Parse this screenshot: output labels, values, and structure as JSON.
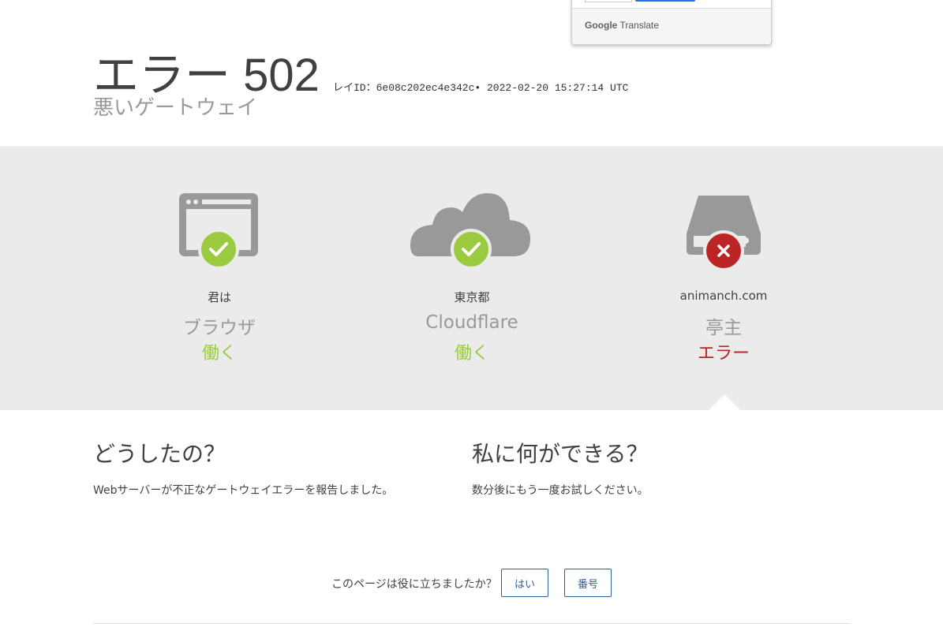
{
  "header": {
    "title": "エラー 502",
    "ray_id": "レイID：6e08c202ec4e342c• 2022-02-20 15:27:14 UTC",
    "subtitle": "悪いゲートウェイ"
  },
  "translate_popup": {
    "logo_google": "Google",
    "logo_translate": "Translate"
  },
  "status_columns": [
    {
      "location": "君は",
      "name": "ブラウザ",
      "status": "働く",
      "icon": "browser-icon",
      "result": "ok"
    },
    {
      "location": "東京都",
      "name": "Cloudflare",
      "status": "働く",
      "icon": "cloud-icon",
      "result": "ok"
    },
    {
      "location": "animanch.com",
      "name": "亭主",
      "status": "エラー",
      "icon": "server-icon",
      "result": "error"
    }
  ],
  "info": {
    "what_happened_title": "どうしたの？",
    "what_happened_text": "Webサーバーが不正なゲートウェイエラーを報告しました。",
    "what_can_i_do_title": "私に何ができる？",
    "what_can_i_do_text": "数分後にもう一度お試しください。"
  },
  "feedback": {
    "question": "このページは役に立ちましたか？",
    "yes_label": "はい",
    "no_label": "番号"
  },
  "colors": {
    "ok": "#9bca3e",
    "error": "#bd2426",
    "band": "#ebebeb",
    "icon_gray": "#999999",
    "button_blue": "#2f5f9e"
  }
}
